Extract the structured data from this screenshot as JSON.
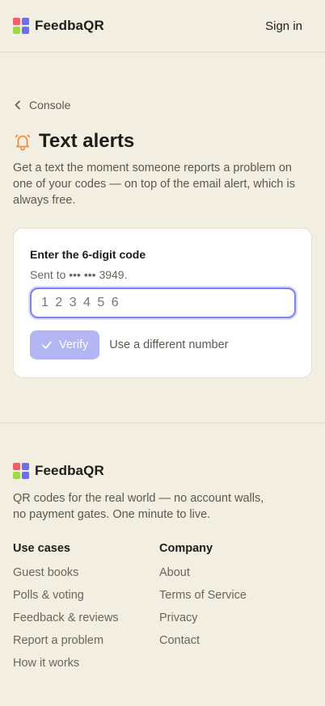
{
  "header": {
    "brand": "FeedbaQR",
    "signin_label": "Sign in",
    "logo_colors": [
      "#f0606a",
      "#6b6ff0",
      "#9fd84a",
      "#6b6ff0"
    ]
  },
  "main": {
    "back_label": "Console",
    "title": "Text alerts",
    "description": "Get a text the moment someone reports a problem on one of your codes — on top of the email alert, which is always free.",
    "card": {
      "heading": "Enter the 6-digit code",
      "sent_to": "Sent to ••• ••• 3949.",
      "code_placeholder": "1 2 3 4 5 6",
      "verify_label": "Verify",
      "alt_label": "Use a different number"
    }
  },
  "footer": {
    "brand": "FeedbaQR",
    "tagline_line1": "QR codes for the real world — no account walls,",
    "tagline_line2": "no payment gates. One minute to live.",
    "columns": [
      {
        "heading": "Use cases",
        "items": [
          "Guest books",
          "Polls & voting",
          "Feedback & reviews",
          "Report a problem",
          "How it works"
        ]
      },
      {
        "heading": "Company",
        "items": [
          "About",
          "Terms of Service",
          "Privacy",
          "Contact"
        ]
      }
    ]
  },
  "colors": {
    "background": "#f3eee2",
    "accent": "#7f82e8",
    "button_disabled": "#b4b6f4",
    "bell": "#f0903a"
  }
}
